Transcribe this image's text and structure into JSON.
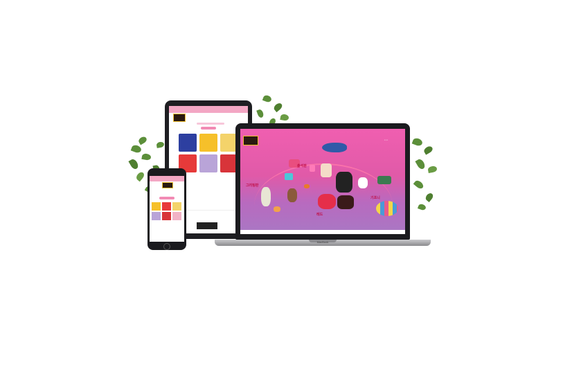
{
  "laptop": {
    "brand_label": "MacBook",
    "screen_labels": [
      "출석판",
      "그리팅판",
      "레드",
      "기프니"
    ]
  },
  "colors": {
    "accent_pink": "#f05fb0",
    "header_pink": "#f3a7c4",
    "plant_green": "#5c8f3a"
  }
}
